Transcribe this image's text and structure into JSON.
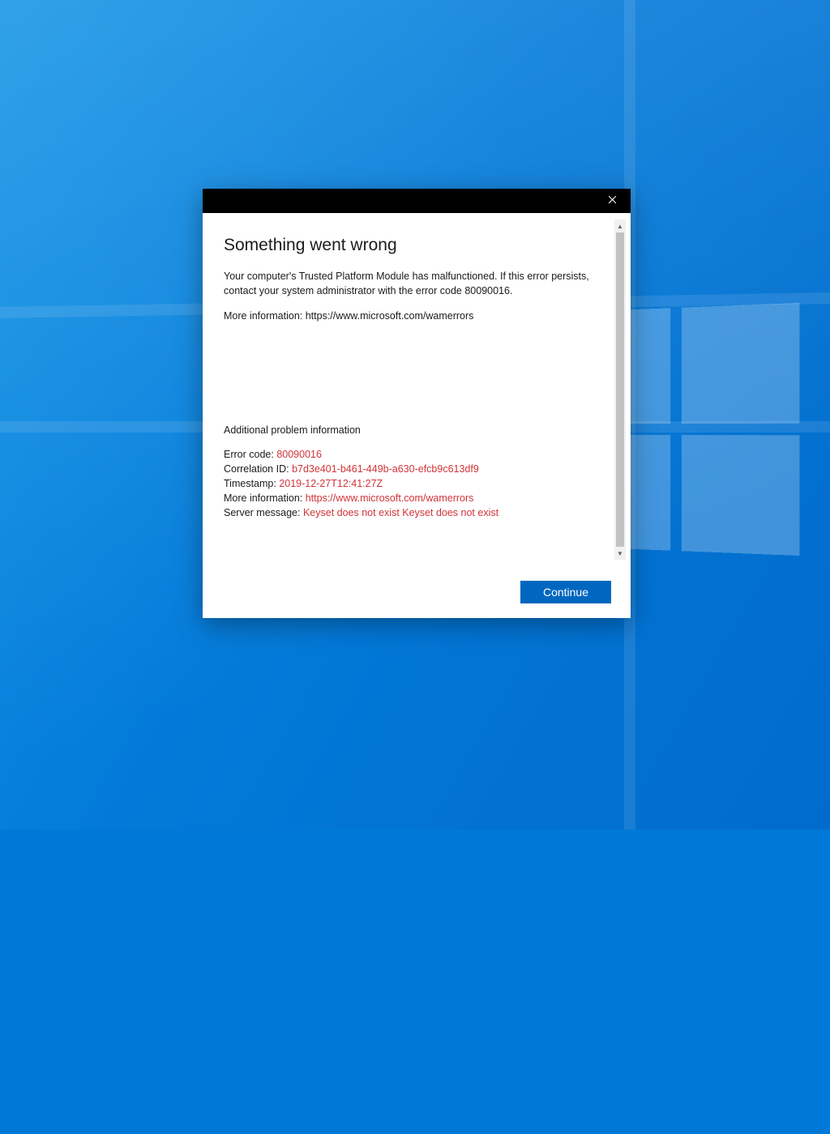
{
  "dialog": {
    "title": "Something went wrong",
    "message_line1": "Your computer's Trusted Platform Module has malfunctioned. If this error persists, contact your system administrator with the error code 80090016.",
    "message_line2": "More information: https://www.microsoft.com/wamerrors",
    "additional_heading": "Additional problem information",
    "fields": {
      "error_code_label": "Error code: ",
      "error_code_value": "80090016",
      "correlation_label": "Correlation ID: ",
      "correlation_value": "b7d3e401-b461-449b-a630-efcb9c613df9",
      "timestamp_label": "Timestamp: ",
      "timestamp_value": "2019-12-27T12:41:27Z",
      "moreinfo_label": "More information: ",
      "moreinfo_value": "https://www.microsoft.com/wamerrors",
      "server_label": "Server message: ",
      "server_value": "Keyset does not exist Keyset does not exist"
    },
    "continue_label": "Continue"
  },
  "colors": {
    "accent": "#0067c0",
    "error_text": "#d13438",
    "titlebar": "#000000"
  }
}
